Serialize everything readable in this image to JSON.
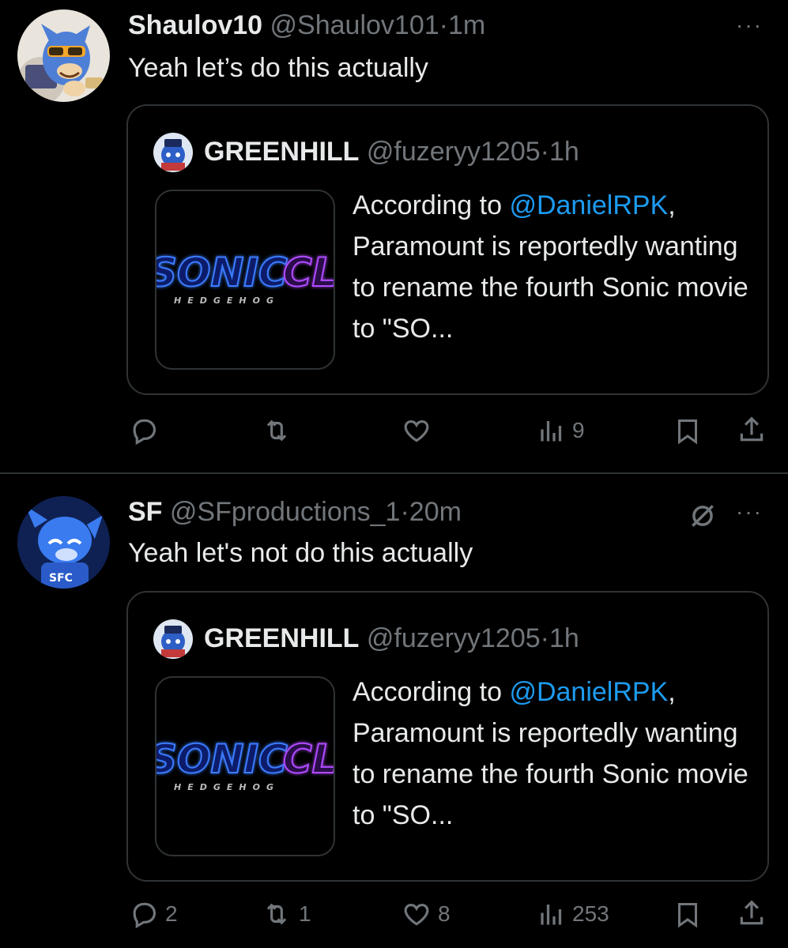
{
  "tweets": [
    {
      "display_name": "Shaulov10",
      "handle": "@Shaulov101",
      "separator": "·",
      "time": "1m",
      "text": "Yeah let’s do this actually",
      "more": "···",
      "quote": {
        "display_name": "GREENHILL",
        "handle": "@fuzeryy1205",
        "separator": "·",
        "time": "1h",
        "text_before": "According to ",
        "mention": "@DanielRPK",
        "text_after": ", Paramount is reportedly wanting to rename the fourth Sonic movie to \"SO...",
        "thumb": {
          "logo": "SONIC",
          "logo2": "CL",
          "sub": "HEDGEHOG"
        }
      },
      "actions": {
        "replies": "",
        "reposts": "",
        "likes": "",
        "views": "9"
      }
    },
    {
      "display_name": "SF",
      "handle": "@SFproductions_1",
      "separator": "·",
      "time": "20m",
      "text": "Yeah let's not do this actually",
      "more": "···",
      "quote": {
        "display_name": "GREENHILL",
        "handle": "@fuzeryy1205",
        "separator": "·",
        "time": "1h",
        "text_before": "According to ",
        "mention": "@DanielRPK",
        "text_after": ", Paramount is reportedly wanting to rename the fourth Sonic movie to \"SO...",
        "thumb": {
          "logo": "SONIC",
          "logo2": "CL",
          "sub": "HEDGEHOG"
        }
      },
      "actions": {
        "replies": "2",
        "reposts": "1",
        "likes": "8",
        "views": "253"
      }
    }
  ],
  "colors": {
    "background": "#000000",
    "text": "#e7e9ea",
    "muted": "#71767b",
    "link": "#1d9bf0",
    "border": "#2f3336"
  },
  "icons": [
    "reply-icon",
    "repost-icon",
    "like-icon",
    "views-icon",
    "bookmark-icon",
    "share-icon",
    "grok-icon",
    "more-icon"
  ]
}
